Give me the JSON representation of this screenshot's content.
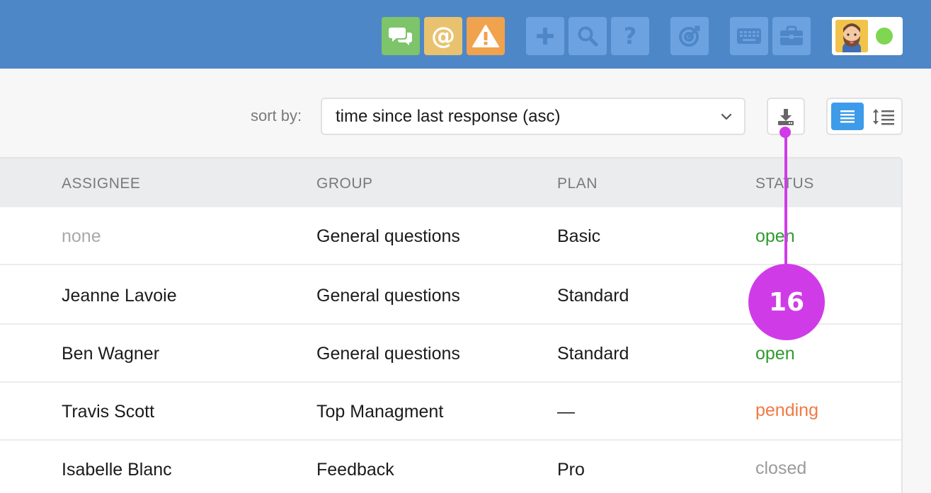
{
  "icons": {
    "chat": "chat-icon",
    "mention": "at-icon",
    "alert": "alert-icon",
    "plus": "plus-icon",
    "search": "search-icon",
    "help": "help-icon",
    "target": "target-icon",
    "keyboard": "keyboard-icon",
    "briefcase": "briefcase-icon",
    "download": "download-icon",
    "list_view": "list-view-icon",
    "compact_view": "compact-view-icon",
    "chevron": "chevron-down-icon"
  },
  "colors": {
    "topbar": "#4e87c7",
    "chat": "#7ec46a",
    "mention": "#e9c26f",
    "alert": "#f0a24d",
    "toolbar_button": "#6da2e0",
    "online": "#7fd651",
    "status_open": "#2e9b2e",
    "status_pending": "#f07a45",
    "status_closed": "#9b9b9b",
    "annotation": "#cf3ce7",
    "active_view": "#3d9be9"
  },
  "header": {
    "mention_symbol": "@",
    "help_symbol": "?"
  },
  "sort": {
    "label": "sort by:",
    "value": "time since last response (asc)"
  },
  "table": {
    "columns": [
      "ASSIGNEE",
      "GROUP",
      "PLAN",
      "STATUS"
    ],
    "rows": [
      {
        "assignee": "none",
        "group": "General questions",
        "plan": "Basic",
        "status": "open"
      },
      {
        "assignee": "Jeanne Lavoie",
        "group": "General questions",
        "plan": "Standard",
        "status": ""
      },
      {
        "assignee": "Ben Wagner",
        "group": "General questions",
        "plan": "Standard",
        "status": "open"
      },
      {
        "assignee": "Travis Scott",
        "group": "Top Managment",
        "plan": "—",
        "status": "pending"
      },
      {
        "assignee": "Isabelle Blanc",
        "group": "Feedback",
        "plan": "Pro",
        "status": "closed"
      }
    ]
  },
  "annotation": {
    "number": "16"
  }
}
